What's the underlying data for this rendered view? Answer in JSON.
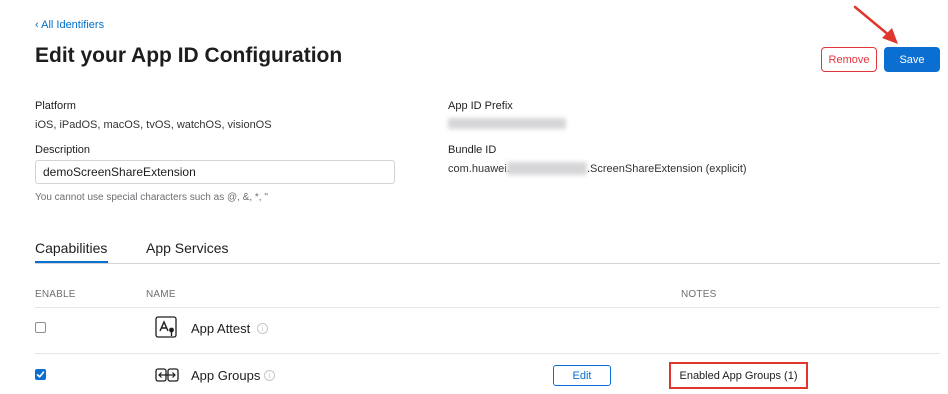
{
  "header": {
    "back_link": "‹ All Identifiers",
    "title": "Edit your App ID Configuration",
    "remove_label": "Remove",
    "save_label": "Save"
  },
  "form": {
    "platform_label": "Platform",
    "platform_value": "iOS, iPadOS, macOS, tvOS, watchOS, visionOS",
    "description_label": "Description",
    "description_value": "demoScreenShareExtension",
    "description_help": "You cannot use special characters such as @, &, *, \"",
    "prefix_label": "App ID Prefix",
    "bundle_label": "Bundle ID",
    "bundle_prefix": "com.huawei.",
    "bundle_suffix": ".ScreenShareExtension (explicit)"
  },
  "tabs": [
    {
      "label": "Capabilities",
      "active": true
    },
    {
      "label": "App Services",
      "active": false
    }
  ],
  "table": {
    "headers": {
      "enable": "ENABLE",
      "name": "NAME",
      "notes": "NOTES"
    },
    "rows": [
      {
        "name": "App Attest",
        "enabled": false,
        "icon": "app-attest-icon",
        "info": "i"
      },
      {
        "name": "App Groups",
        "enabled": true,
        "icon": "app-groups-icon",
        "info": "i",
        "edit_label": "Edit",
        "notes": "Enabled App Groups (1)"
      }
    ]
  },
  "colors": {
    "accent": "#0a6fd1",
    "danger": "#e0363c",
    "annotation": "#e0362d"
  }
}
